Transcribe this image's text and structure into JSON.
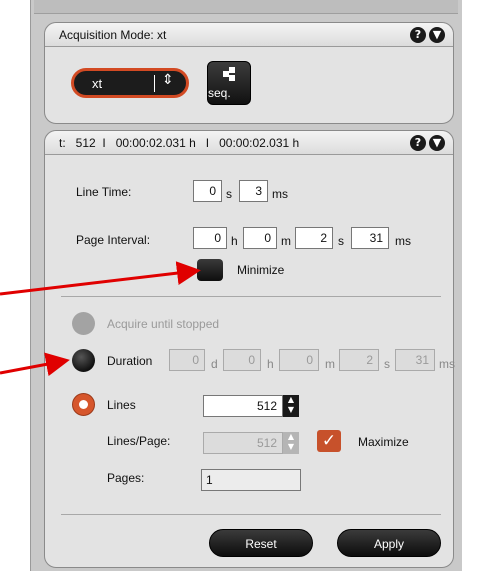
{
  "acquisition": {
    "title": "Acquisition Mode: xt",
    "mode_value": "xt",
    "seq_label": "seq."
  },
  "timing": {
    "header": "t:   512  I   00:00:02.031 h   I   00:00:02.031 h",
    "line_time": {
      "label": "Line Time:",
      "s": "0",
      "ms": "3"
    },
    "page_interval": {
      "label": "Page Interval:",
      "h": "0",
      "m": "0",
      "s": "2",
      "ms": "31"
    },
    "minimize_label": "Minimize"
  },
  "modes": {
    "acquire_label": "Acquire until stopped",
    "duration": {
      "label": "Duration",
      "d": "0",
      "h": "0",
      "m": "0",
      "s": "2",
      "ms": "31"
    },
    "lines": {
      "label": "Lines",
      "value": "512"
    },
    "lines_per_page": {
      "label": "Lines/Page:",
      "value": "512"
    },
    "maximize_label": "Maximize",
    "pages": {
      "label": "Pages:",
      "value": "1"
    }
  },
  "units": {
    "s": "s",
    "ms": "ms",
    "h": "h",
    "m": "m",
    "d": "d"
  },
  "buttons": {
    "reset": "Reset",
    "apply": "Apply"
  },
  "icons": {
    "help": "?",
    "collapse": "▼"
  },
  "colors": {
    "accent": "#d24a23",
    "arrow": "#e00000"
  }
}
